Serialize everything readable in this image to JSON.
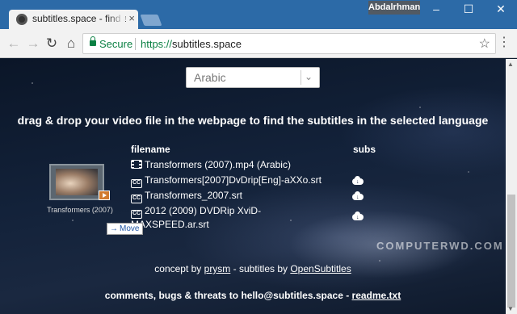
{
  "browser": {
    "tab_title": "subtitles.space - find and",
    "user": "Abdalrhman",
    "secure_label": "Secure",
    "url_scheme": "https://",
    "url_host": "subtitles.space"
  },
  "page": {
    "language": "Arabic",
    "headline": "drag & drop your video file in the webpage to find the subtitles in the selected language",
    "columns": {
      "filename": "filename",
      "subs": "subs"
    },
    "video_file": "Transformers (2007).mp4 (Arabic)",
    "subtitles": [
      "Transformers[2007]DvDrip[Eng]-aXXo.srt",
      "Transformers_2007.srt",
      "2012 (2009) DVDRip XviD-MAXSPEED.ar.srt"
    ],
    "dragged_file_caption": "Transformers (2007)",
    "drag_action": "Move",
    "credits": {
      "prefix": "concept by ",
      "author": "prysm",
      "middle": " - subtitles by ",
      "provider": "OpenSubtitles"
    },
    "contact": {
      "text": "comments, bugs & threats to hello@subtitles.space - ",
      "link": "readme.txt"
    },
    "watermark": "COMPUTERWD.COM"
  },
  "colors": {
    "titlebar": "#2c6aa7",
    "secure": "#0b8043"
  },
  "icons": [
    "back-icon",
    "forward-icon",
    "reload-icon",
    "home-icon",
    "lock-icon",
    "star-icon",
    "menu-icon",
    "film-icon",
    "cc-icon",
    "download-icon"
  ]
}
